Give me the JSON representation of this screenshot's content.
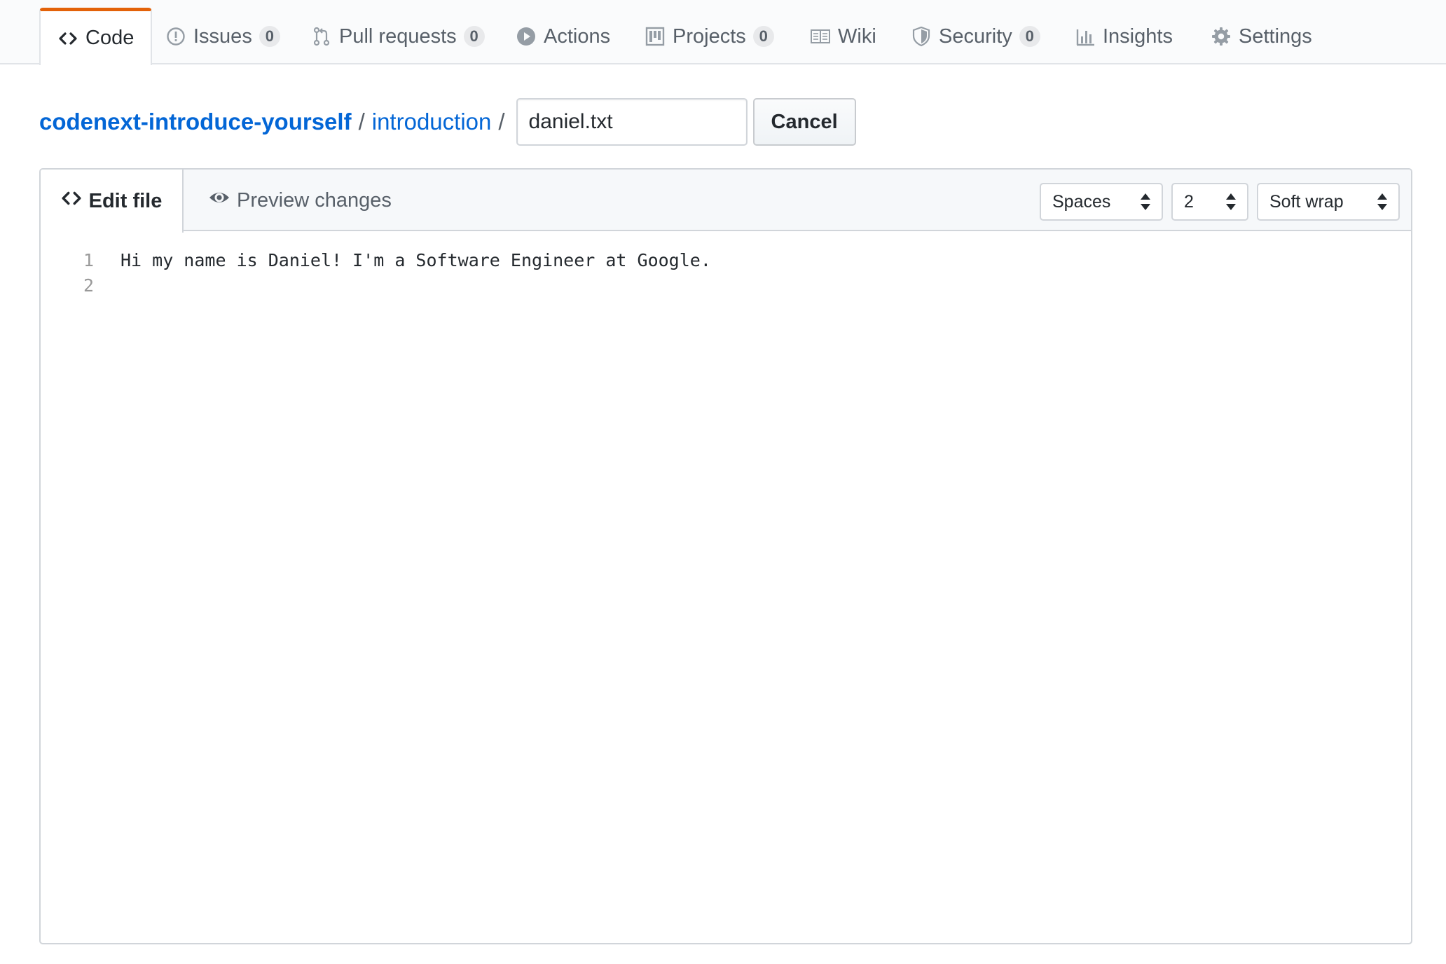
{
  "nav": {
    "tabs": [
      {
        "label": "Code",
        "icon": "code-icon",
        "selected": true
      },
      {
        "label": "Issues",
        "icon": "issue-icon",
        "count": "0"
      },
      {
        "label": "Pull requests",
        "icon": "git-pull-request-icon",
        "count": "0"
      },
      {
        "label": "Actions",
        "icon": "play-icon"
      },
      {
        "label": "Projects",
        "icon": "project-icon",
        "count": "0"
      },
      {
        "label": "Wiki",
        "icon": "book-icon"
      },
      {
        "label": "Security",
        "icon": "shield-icon",
        "count": "0"
      },
      {
        "label": "Insights",
        "icon": "graph-icon"
      },
      {
        "label": "Settings",
        "icon": "gear-icon"
      }
    ]
  },
  "breadcrumb": {
    "repo": "codenext-introduce-yourself",
    "folder": "introduction",
    "separator": "/",
    "filename_value": "daniel.txt",
    "cancel_label": "Cancel"
  },
  "editor": {
    "edit_tab": "Edit file",
    "preview_tab": "Preview changes",
    "indent_mode": "Spaces",
    "indent_size": "2",
    "wrap_mode": "Soft wrap",
    "lines": [
      {
        "number": "1",
        "text": "Hi my name is Daniel! I'm a Software Engineer at Google."
      },
      {
        "number": "2",
        "text": ""
      }
    ]
  },
  "colors": {
    "link": "#0366d6",
    "selected_tab_accent": "#e36209",
    "border": "#d1d5da"
  }
}
